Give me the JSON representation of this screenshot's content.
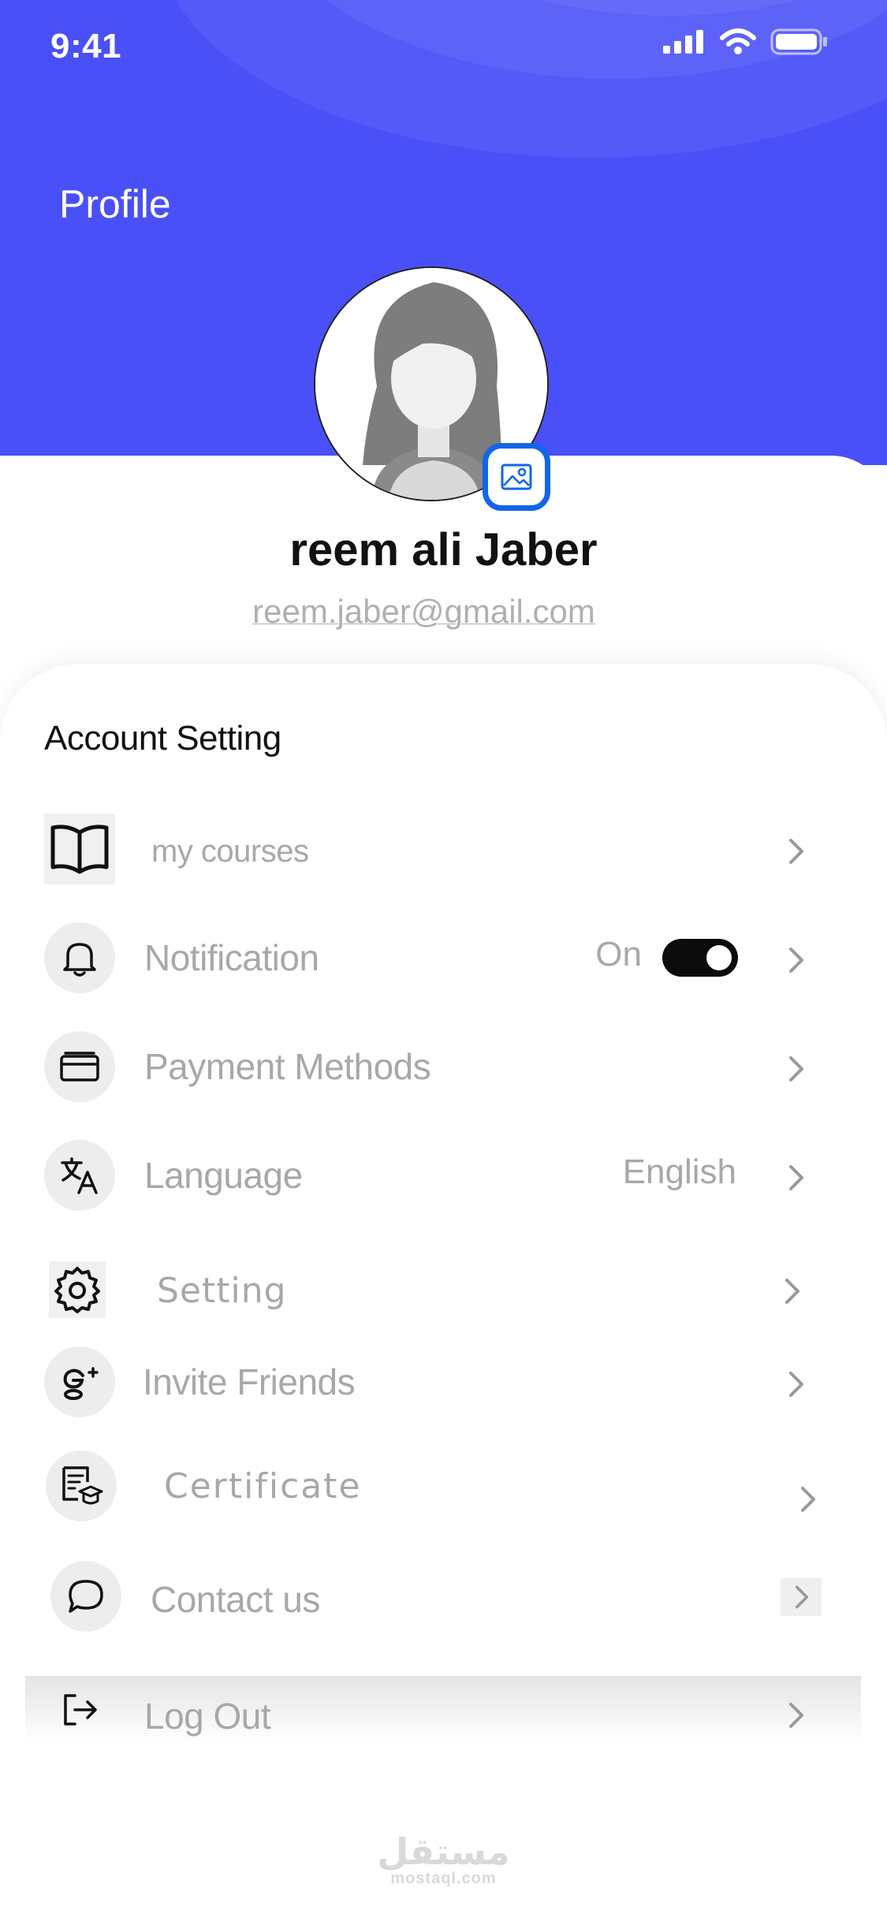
{
  "status_bar": {
    "time": "9:41"
  },
  "header": {
    "title": "Profile"
  },
  "profile": {
    "name": "reem ali Jaber",
    "email": "reem.jaber@gmail.com"
  },
  "section": {
    "title": "Account Setting"
  },
  "items": [
    {
      "label": "my courses",
      "icon": "book-icon"
    },
    {
      "label": "Notification",
      "icon": "bell-icon",
      "value": "On",
      "toggle_on": true
    },
    {
      "label": "Payment Methods",
      "icon": "credit-card-icon"
    },
    {
      "label": "Language",
      "icon": "translate-icon",
      "value": "English"
    },
    {
      "label": "Setting",
      "icon": "gear-icon"
    },
    {
      "label": "Invite Friends",
      "icon": "google-plus-icon"
    },
    {
      "label": "Certificate",
      "icon": "certificate-icon"
    },
    {
      "label": "Contact us",
      "icon": "chat-bubble-icon"
    },
    {
      "label": "Log Out",
      "icon": "logout-icon"
    }
  ],
  "watermark": {
    "arabic": "مستقل",
    "latin": "mostaql.com"
  },
  "colors": {
    "header_bg": "#4a50f7",
    "edit_border": "#1166e8",
    "toggle_bg": "#0b0b0b",
    "label_gray": "#a8a8a8"
  }
}
